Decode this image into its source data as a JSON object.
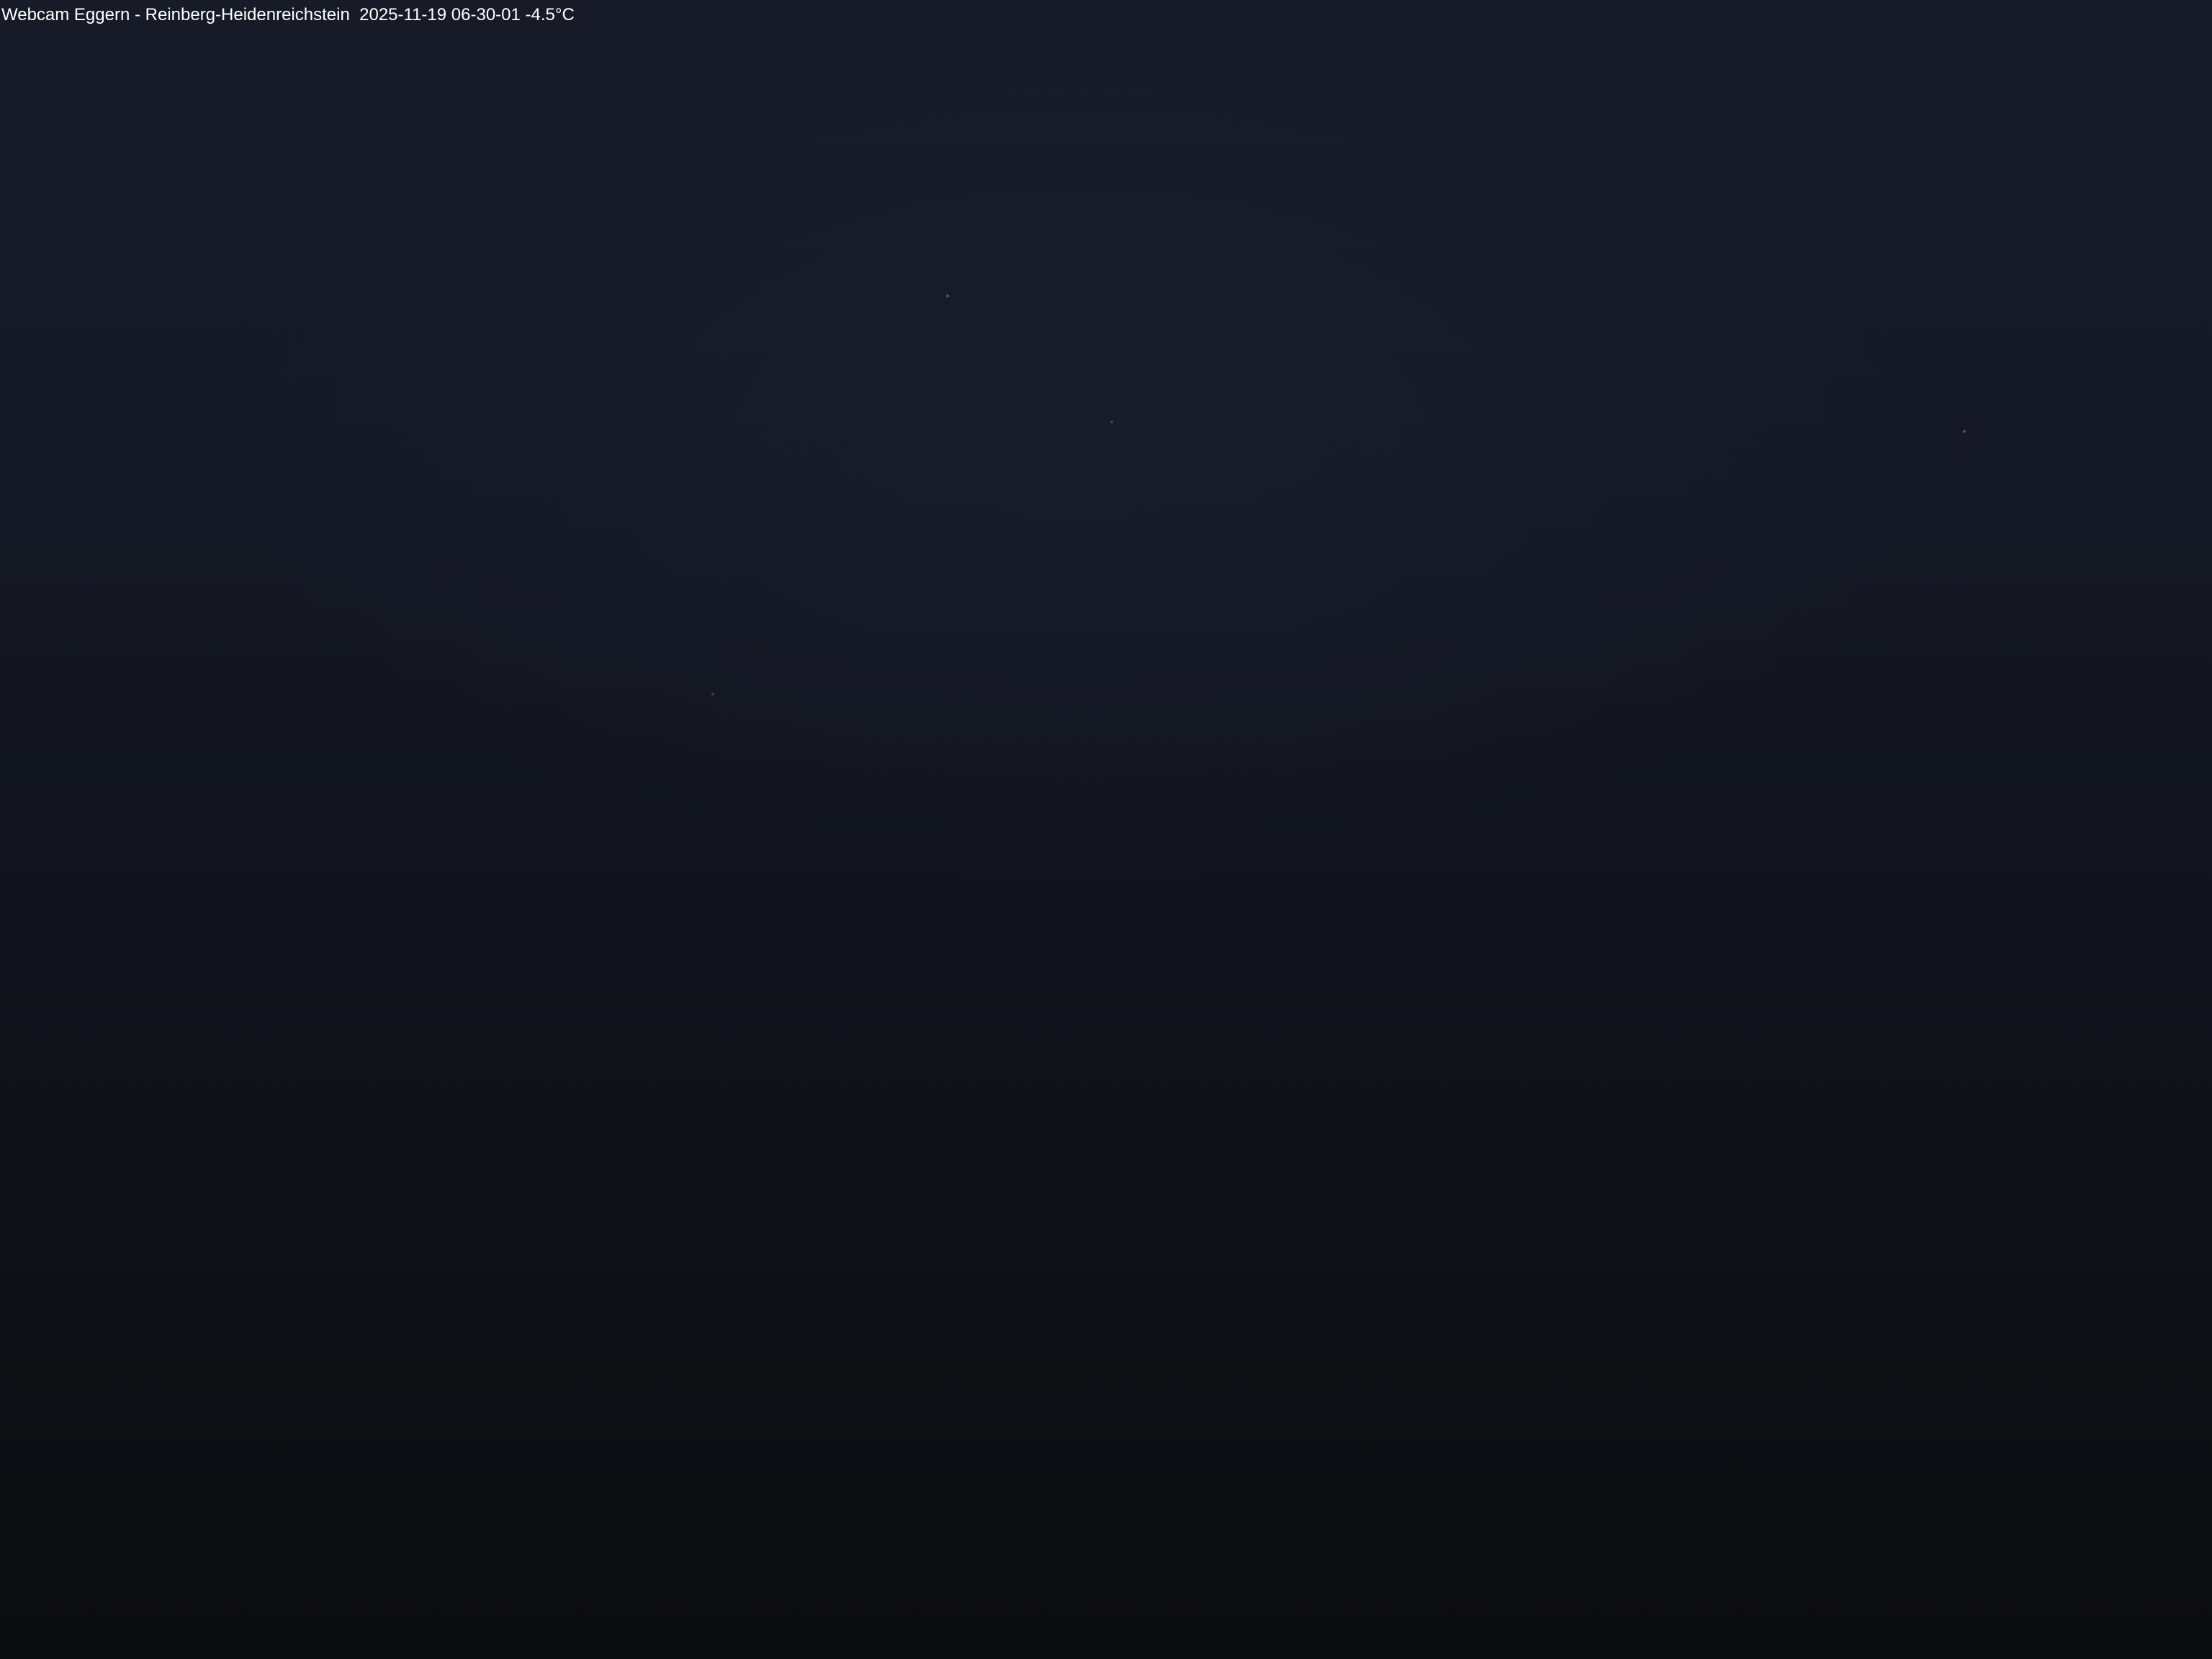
{
  "overlay": {
    "caption": "Webcam Eggern - Reinberg-Heidenreichstein  2025-11-19 06-30-01 -4.5°C"
  },
  "scene": {
    "description_colors": {
      "sky_top": "#171b28",
      "sky_bottom": "#0b0c0f",
      "text": "#ffffff"
    }
  }
}
